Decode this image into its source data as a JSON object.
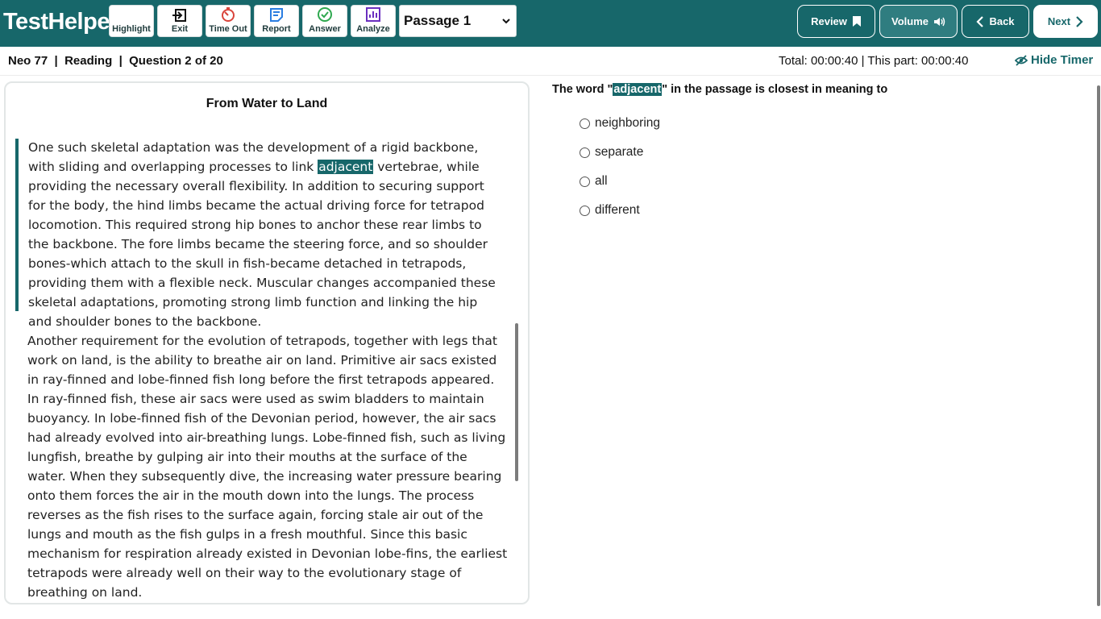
{
  "brand": "TestHelper",
  "toolbar": [
    {
      "label": "Highlight",
      "icon": "highlight-icon"
    },
    {
      "label": "Exit",
      "icon": "exit-icon"
    },
    {
      "label": "Time Out",
      "icon": "timer-icon"
    },
    {
      "label": "Report",
      "icon": "report-icon"
    },
    {
      "label": "Answer",
      "icon": "check-circle-icon"
    },
    {
      "label": "Analyze",
      "icon": "chart-icon"
    }
  ],
  "passage_select": {
    "value": "Passage 1"
  },
  "nav": {
    "review": "Review",
    "volume": "Volume",
    "back": "Back",
    "next": "Next"
  },
  "info": {
    "test": "Neo 77",
    "sep1": "  |  ",
    "section": "Reading",
    "sep2": "  |  ",
    "question": "Question 2 of 20",
    "timer": "Total: 00:00:40 | This part: 00:00:40",
    "hide_timer": "Hide Timer"
  },
  "passage": {
    "title": "From Water to Land",
    "p1_before": "One such skeletal adaptation was the development of a rigid backbone, with sliding and overlapping processes to link ",
    "p1_highlight": "adjacent",
    "p1_after": " vertebrae, while providing the necessary overall flexibility. In addition to securing support for the body, the hind limbs became the actual driving force for tetrapod locomotion. This required strong hip bones to anchor these rear limbs to the backbone. The fore limbs became the steering force, and so shoulder bones-which attach to the skull in fish-became detached in tetrapods, providing them with a flexible neck. Muscular changes accompanied these skeletal adaptations, promoting strong limb function and linking the hip and shoulder bones to the backbone.",
    "p2": "Another requirement for the evolution of tetrapods, together with legs that work on land, is the ability to breathe air on land. Primitive air sacs existed in ray-finned and lobe-finned fish long before the first tetrapods appeared. In ray-finned fish, these air sacs were used as swim bladders to maintain buoyancy. In lobe-finned fish of the Devonian period, however, the air sacs had already evolved into air-breathing lungs. Lobe-finned fish, such as living lungfish, breathe by gulping air into their mouths at the surface of the water. When they subsequently dive, the increasing water pressure bearing onto them forces the air in the mouth down into the lungs. The process reverses as the fish rises to the surface again, forcing stale air out of the lungs and mouth as the fish gulps in a fresh mouthful. Since this basic mechanism for respiration already existed in Devonian lobe-fins, the earliest tetrapods were already well on their way to the evolutionary stage of breathing on land."
  },
  "question": {
    "before": "The word \"",
    "highlight": "adjacent",
    "after": "\" in the passage is closest in meaning to",
    "options": [
      "neighboring",
      "separate",
      "all",
      "different"
    ]
  },
  "colors": {
    "brand": "#17676a",
    "highlight": "#17676a"
  }
}
